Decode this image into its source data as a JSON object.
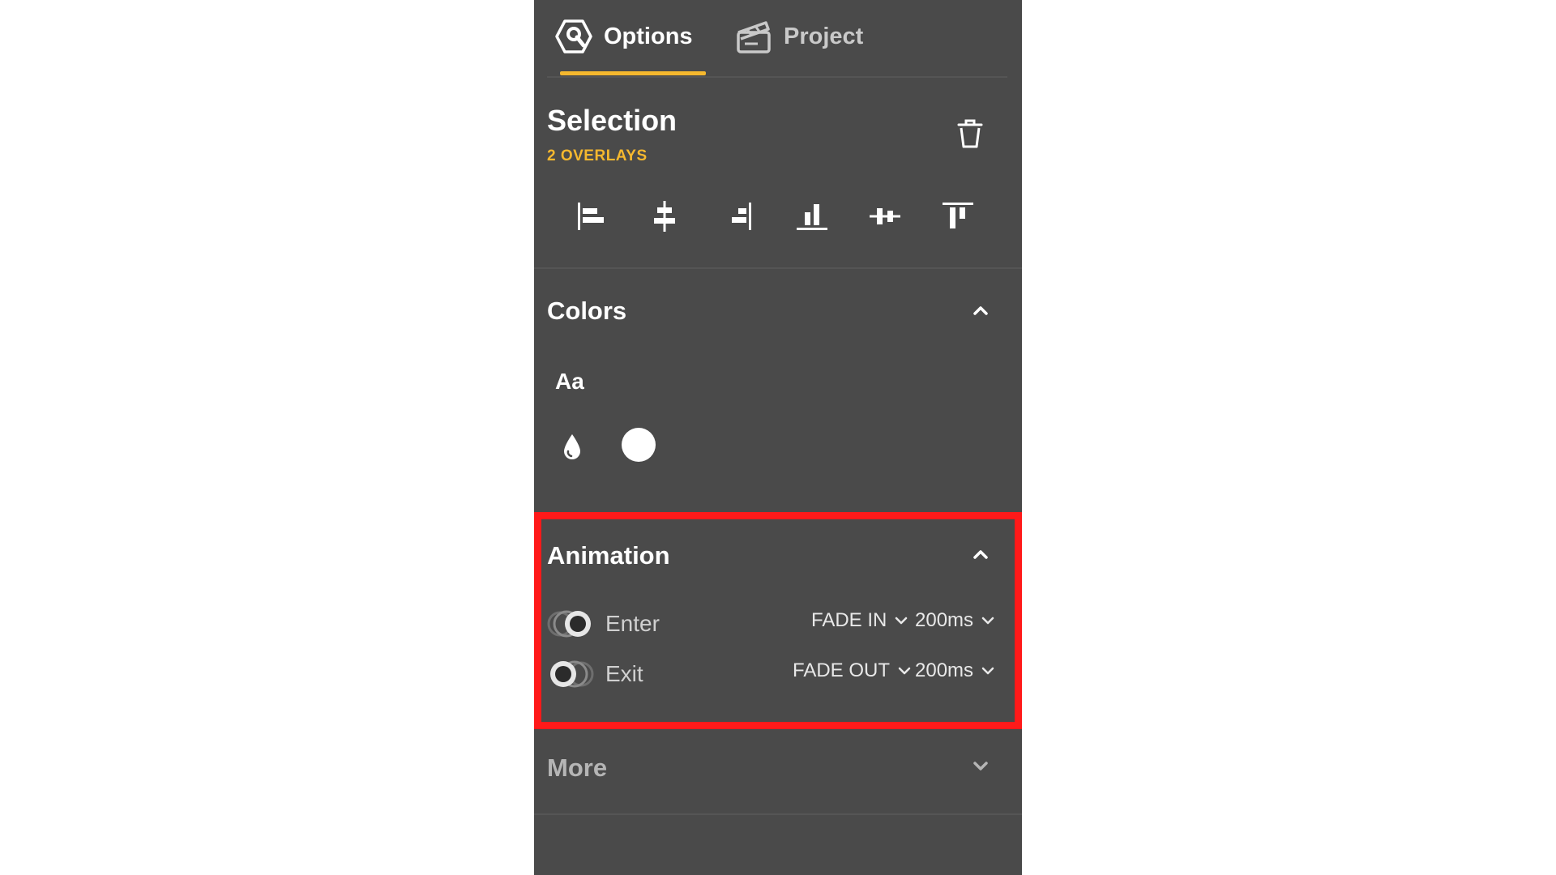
{
  "tabs": [
    {
      "label": "Options",
      "icon": "options-icon",
      "active": true
    },
    {
      "label": "Project",
      "icon": "project-icon",
      "active": false
    }
  ],
  "selection": {
    "title": "Selection",
    "subtitle": "2 OVERLAYS",
    "delete_icon": "trash-icon",
    "align_icons": [
      "align-left-icon",
      "align-horizontal-center-icon",
      "align-right-icon",
      "align-bottom-icon",
      "align-vertical-center-icon",
      "align-top-icon"
    ]
  },
  "colors": {
    "title": "Colors",
    "text_sample": "Aa",
    "fill_icon": "droplet-icon",
    "swatch_color": "#ffffff"
  },
  "animation": {
    "title": "Animation",
    "rows": [
      {
        "label": "Enter",
        "enabled": true,
        "effect": "FADE IN",
        "duration": "200ms"
      },
      {
        "label": "Exit",
        "enabled": false,
        "effect": "FADE OUT",
        "duration": "200ms"
      }
    ]
  },
  "more": {
    "title": "More"
  },
  "colors_palette": {
    "panel_bg": "#4a4a4a",
    "accent": "#f5b82e",
    "highlight": "#ff1a1a"
  }
}
